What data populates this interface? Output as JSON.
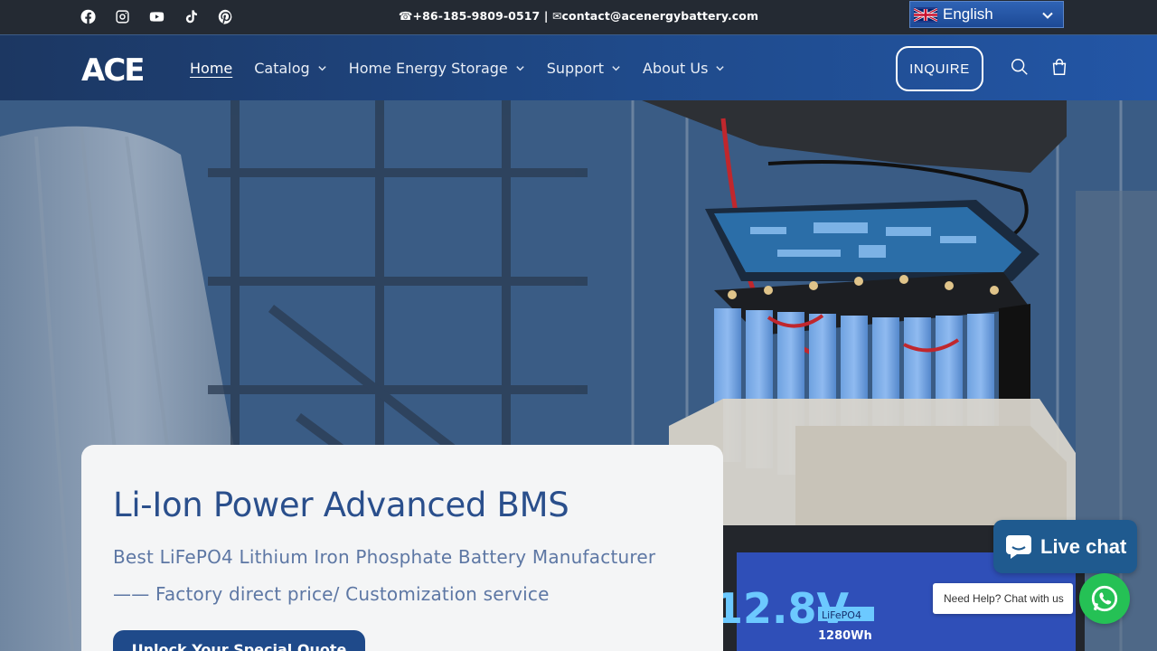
{
  "topbar": {
    "socials": [
      "facebook-icon",
      "instagram-icon",
      "youtube-icon",
      "tiktok-icon",
      "pinterest-icon"
    ],
    "phone": "+86-185-9809-0517",
    "separator": "|",
    "email": "contact@acenergybattery.com",
    "language": "English"
  },
  "header": {
    "logo_text": "ACE",
    "nav": [
      {
        "label": "Home",
        "active": true
      },
      {
        "label": "Catalog",
        "dropdown": true
      },
      {
        "label": "Home Energy Storage",
        "dropdown": true
      },
      {
        "label": "Support",
        "dropdown": true
      },
      {
        "label": "About Us",
        "dropdown": true
      }
    ],
    "inquire_label": "INQUIRE"
  },
  "hero": {
    "title": "Li-Ion Power Advanced BMS",
    "subtitle_line1": "Best LiFePO4 Lithium Iron Phosphate Battery Manufacturer",
    "subtitle_line2": "—— Factory direct price/ Customization service",
    "cta_label": "Unlock Your Special Quote",
    "battery_voltage_text": "12.8V",
    "battery_chem_text": "LiFePO4",
    "battery_energy_text": "1280Wh"
  },
  "chat": {
    "live_chat_label": "Live chat",
    "help_text": "Need Help? Chat with us"
  },
  "colors": {
    "topbar_bg": "#242a33",
    "header_bg": "#1f4a8a",
    "title_color": "#2a4f8c",
    "cta_bg": "#1f4a8a",
    "whatsapp_green": "#25c155"
  }
}
